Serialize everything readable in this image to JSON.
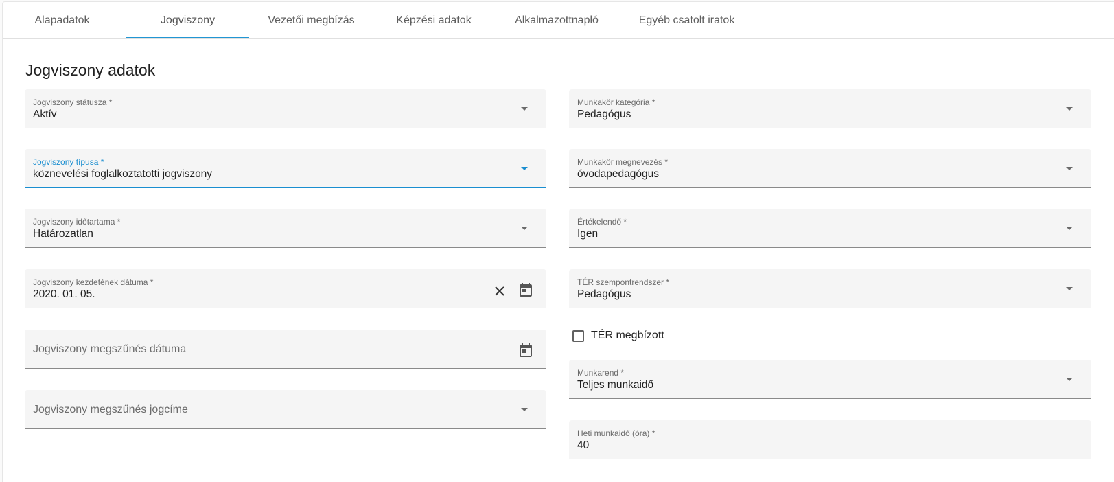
{
  "tabs": [
    {
      "label": "Alapadatok"
    },
    {
      "label": "Jogviszony"
    },
    {
      "label": "Vezetői megbízás"
    },
    {
      "label": "Képzési adatok"
    },
    {
      "label": "Alkalmazottnapló"
    },
    {
      "label": "Egyéb csatolt iratok"
    }
  ],
  "active_tab": "Jogviszony",
  "section_title": "Jogviszony adatok",
  "left": {
    "status": {
      "label": "Jogviszony státusza *",
      "value": "Aktív"
    },
    "type": {
      "label": "Jogviszony típusa *",
      "value": "köznevelési foglalkoztatotti jogviszony"
    },
    "duration": {
      "label": "Jogviszony időtartama *",
      "value": "Határozatlan"
    },
    "start_date": {
      "label": "Jogviszony kezdetének dátuma *",
      "value": "2020. 01. 05."
    },
    "end_date": {
      "placeholder": "Jogviszony megszűnés dátuma"
    },
    "end_reason": {
      "placeholder": "Jogviszony megszűnés jogcíme"
    }
  },
  "right": {
    "job_category": {
      "label": "Munkakör kategória *",
      "value": "Pedagógus"
    },
    "job_title": {
      "label": "Munkakör megnevezés *",
      "value": "óvodapedagógus"
    },
    "evaluable": {
      "label": "Értékelendő *",
      "value": "Igen"
    },
    "ter_system": {
      "label": "TÉR szempontrendszer *",
      "value": "Pedagógus"
    },
    "ter_assigned": {
      "label": "TÉR megbízott",
      "checked": false
    },
    "schedule": {
      "label": "Munkarend *",
      "value": "Teljes munkaidő"
    },
    "weekly_hours": {
      "label": "Heti munkaidő (óra) *",
      "value": "40"
    }
  },
  "colors": {
    "accent": "#1a8ed0",
    "tab_ink": "#2196d3",
    "field_bg": "#f5f5f5"
  },
  "icons": [
    "dropdown-arrow-icon",
    "clear-icon",
    "calendar-icon"
  ]
}
